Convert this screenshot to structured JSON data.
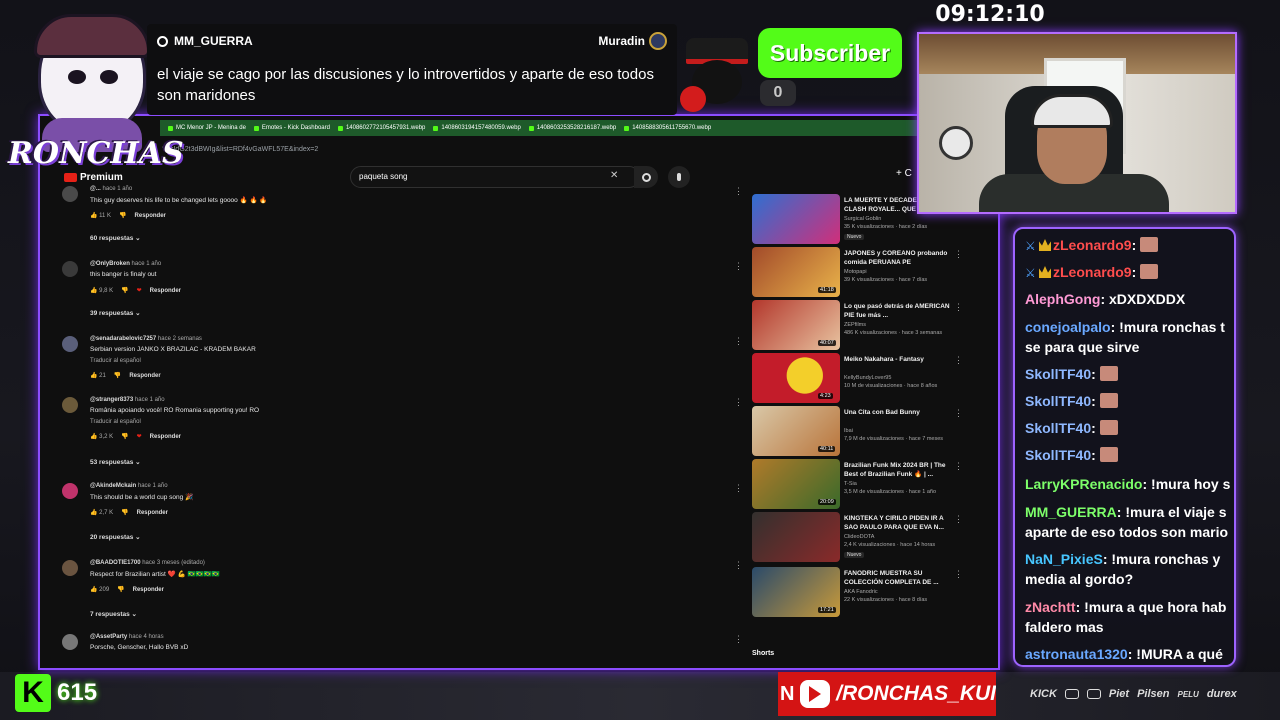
{
  "logo": {
    "name": "RONCHAS",
    "premium_label": "Premium"
  },
  "clock": "09:12:10",
  "popup": {
    "username": "MM_GUERRA",
    "target": "Muradin",
    "message": "el viaje se cago por las discusiones y lo introvertidos y aparte de eso todos son maridones"
  },
  "subscriber": {
    "label": "Subscriber",
    "count": "0"
  },
  "browser": {
    "tabs": [
      "MC Menor JP - Menina de",
      "Emotes - Kick Dashboard",
      "1408602772105457931.webp",
      "1408603194157480059.webp",
      "1408603253528216187.webp",
      "1408588305611755670.webp"
    ],
    "address": "?v=IdG2t3dBWIg&list=RDf4vGaWFL57E&index=2",
    "search_query": "paqueta song",
    "create_label": "+ C"
  },
  "comments": [
    {
      "author": "@...",
      "time": "hace 1 año",
      "text": "This guy deserves his life to be changed lets goooo 🔥 🔥 🔥",
      "likes": "11 K",
      "reply": "Responder",
      "replies": "60 respuestas"
    },
    {
      "author": "@OnlyBroken",
      "time": "hace 1 año",
      "text": "this banger is finaly out",
      "likes": "9,8 K",
      "reply": "Responder",
      "replies": "39 respuestas"
    },
    {
      "author": "@senadarabelovic7257",
      "time": "hace 2 semanas",
      "text": "Serbian version JANKO X BRAZILAC - KRADEM BAKAR",
      "translate": "Traducir al español",
      "likes": "21",
      "reply": "Responder"
    },
    {
      "author": "@stranger8373",
      "time": "hace 1 año",
      "text": "România apoiando você! RO Romania supporting you! RO",
      "translate": "Traducir al español",
      "likes": "3,2 K",
      "reply": "Responder",
      "replies": "53 respuestas"
    },
    {
      "author": "@AkindeMckain",
      "time": "hace 1 año",
      "text": "This should be a world cup song 🎉",
      "likes": "2,7 K",
      "reply": "Responder",
      "replies": "20 respuestas"
    },
    {
      "author": "@BAADOTIE1700",
      "time": "hace 3 meses (editado)",
      "text": "Respect for Brazilian artist ❤️ 💪 🇧🇷🇧🇷🇧🇷🇧🇷",
      "likes": "209",
      "reply": "Responder",
      "replies": "7 respuestas"
    },
    {
      "author": "@AssetParty",
      "time": "hace 4 horas",
      "text": "Porsche, Genscher, Hallo BVB xD"
    }
  ],
  "recs": [
    {
      "title": "LA MUERTE Y DECADENCIA DE CLASH ROYALE... QUE PASÓ?",
      "channel": "Surgical Goblin",
      "stats": "35 K visualizaciones · hace 2 días",
      "badge": "Nuevo",
      "duration": "",
      "thumb": "#2f6fd1"
    },
    {
      "title": "JAPONES y COREANO probando comida PERUANA PE",
      "channel": "Motopapi",
      "stats": "39 K visualizaciones · hace 7 días",
      "duration": "41:18",
      "thumb": "#a24a2a"
    },
    {
      "title": "Lo que pasó detrás de AMERICAN PIE fue más ...",
      "channel": "ZEPfilms",
      "stats": "486 K visualizaciones · hace 3 semanas",
      "duration": "40:07",
      "thumb": "#b3372c"
    },
    {
      "title": "Meiko Nakahara - Fantasy",
      "channel": "KellyBundyLover95",
      "stats": "10 M de visualizaciones · hace 8 años",
      "duration": "4:23",
      "thumb": "#c31c2a"
    },
    {
      "title": "Una Cita con Bad Bunny",
      "channel": "Ibai",
      "stats": "7,9 M de visualizaciones · hace 7 meses",
      "duration": "40:11",
      "thumb": "#d9c8a8"
    },
    {
      "title": "Brazilian Funk Mix 2024 BR | The Best of Brazilian Funk 🔥 | ...",
      "channel": "T-Sia",
      "stats": "3,5 M de visualizaciones · hace 1 año",
      "duration": "20:09",
      "thumb": "#b07a2a"
    },
    {
      "title": "KINGTEKA Y CIRILO PIDEN IR A SAO PAULO PARA QUE EVA N...",
      "channel": "ClideoDOTA",
      "stats": "2,4 K visualizaciones · hace 14 horas",
      "badge": "Nuevo",
      "duration": "",
      "thumb": "#33302e"
    },
    {
      "title": "FANODRIC MUESTRA SU COLECCIÓN COMPLETA DE ...",
      "channel": "AKA Fanodric",
      "stats": "22 K visualizaciones · hace 8 días",
      "duration": "17:21",
      "thumb": "#c89a3a"
    }
  ],
  "shorts_label": "Shorts",
  "chat": [
    {
      "user": "zLeonardo9",
      "color": "#ff4d4d",
      "msg": "",
      "badges": true,
      "emote": true
    },
    {
      "user": "zLeonardo9",
      "color": "#ff4d4d",
      "msg": "",
      "badges": true,
      "emote": true
    },
    {
      "user": "AlephGong",
      "color": "#ff9ad5",
      "msg": "xDXDXDDX"
    },
    {
      "user": "conejoalpalo",
      "color": "#6aa8ff",
      "msg": "!mura ronchas t se para que sirve"
    },
    {
      "user": "SkollTF40",
      "color": "#8fb8ff",
      "msg": "",
      "emote": true
    },
    {
      "user": "SkollTF40",
      "color": "#8fb8ff",
      "msg": "",
      "emote": true
    },
    {
      "user": "SkollTF40",
      "color": "#8fb8ff",
      "msg": "",
      "emote": true
    },
    {
      "user": "SkollTF40",
      "color": "#8fb8ff",
      "msg": "",
      "emote": true
    },
    {
      "user": "LarryKPRenacido",
      "color": "#7dff6a",
      "msg": "!mura hoy s"
    },
    {
      "user": "MM_GUERRA",
      "color": "#7dff6a",
      "msg": "!mura el viaje s aparte de eso todos son mario"
    },
    {
      "user": "NaN_PixieS",
      "color": "#47c6ff",
      "msg": "!mura ronchas y media al gordo?"
    },
    {
      "user": "zNachtt",
      "color": "#ff8aa8",
      "msg": "!mura a que hora hab faldero mas"
    },
    {
      "user": "astronauta1320",
      "color": "#6aa8ff",
      "msg": "!MURA a qué"
    }
  ],
  "kick": {
    "logo": "K",
    "viewers": "615"
  },
  "ytbanner": {
    "prefix": "N",
    "handle": "/RONCHAS_KUI"
  },
  "sponsors": [
    "KICK",
    "Piet",
    "Pilsen",
    "PELU",
    "durex"
  ]
}
